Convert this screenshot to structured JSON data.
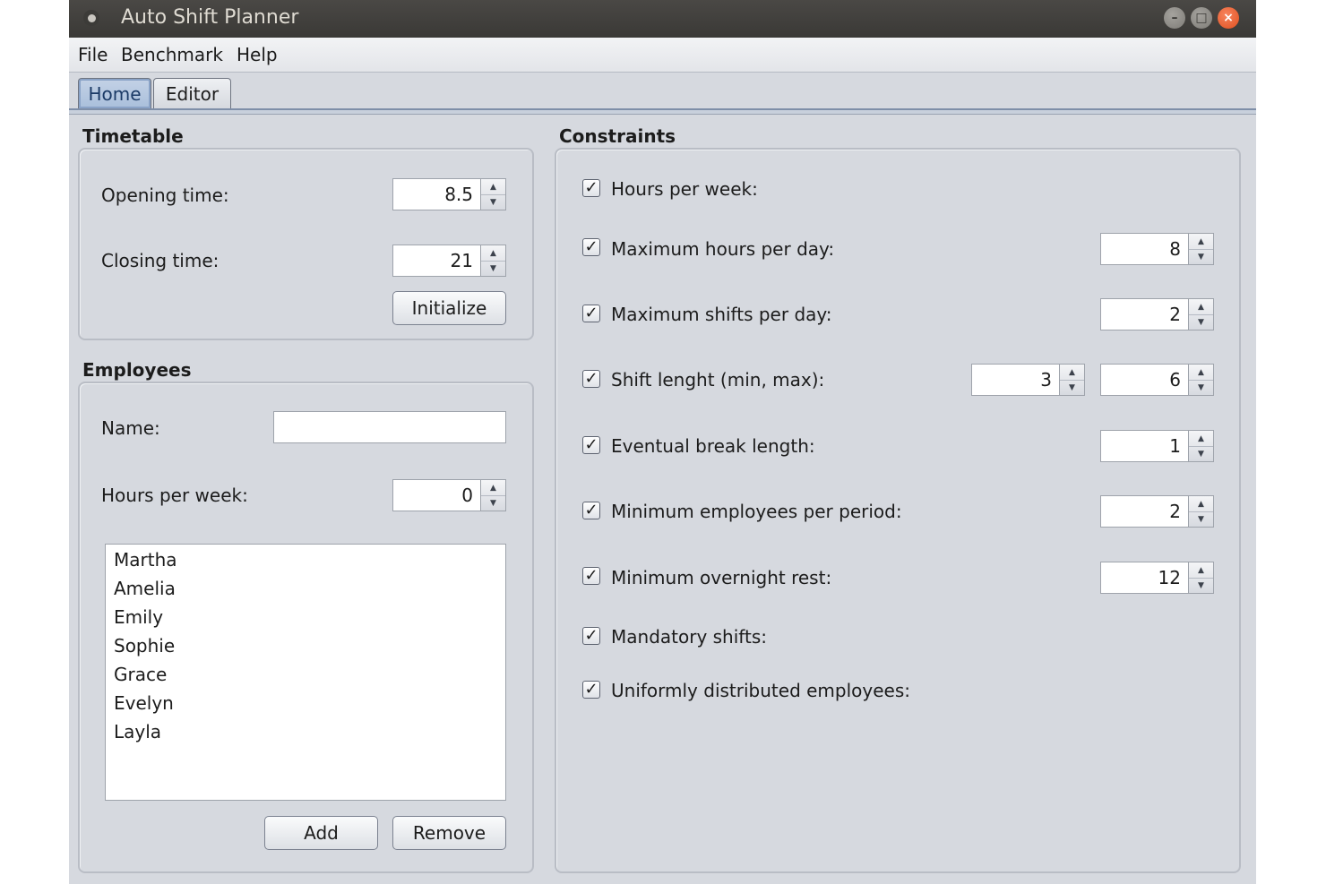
{
  "window": {
    "title": "Auto Shift Planner",
    "controls": {
      "minimize": "–",
      "maximize": "□",
      "close": "×"
    }
  },
  "menu": [
    "File",
    "Benchmark",
    "Help"
  ],
  "tabs": [
    {
      "label": "Home",
      "active": true
    },
    {
      "label": "Editor",
      "active": false
    }
  ],
  "timetable": {
    "title": "Timetable",
    "opening_label": "Opening time:",
    "opening_value": "8.5",
    "closing_label": "Closing time:",
    "closing_value": "21",
    "initialize_button": "Initialize"
  },
  "employees": {
    "title": "Employees",
    "name_label": "Name:",
    "name_value": "",
    "hours_label": "Hours per week:",
    "hours_value": "0",
    "list": [
      "Martha",
      "Amelia",
      "Emily",
      "Sophie",
      "Grace",
      "Evelyn",
      "Layla"
    ],
    "add_button": "Add",
    "remove_button": "Remove"
  },
  "constraints": {
    "title": "Constraints",
    "check_glyph": "✓",
    "items": [
      {
        "label": "Hours per week:",
        "checked": true,
        "values": []
      },
      {
        "label": "Maximum hours per day:",
        "checked": true,
        "values": [
          "8"
        ]
      },
      {
        "label": "Maximum shifts per day:",
        "checked": true,
        "values": [
          "2"
        ]
      },
      {
        "label": "Shift lenght (min, max):",
        "checked": true,
        "values": [
          "3",
          "6"
        ]
      },
      {
        "label": "Eventual break length:",
        "checked": true,
        "values": [
          "1"
        ]
      },
      {
        "label": "Minimum employees per period:",
        "checked": true,
        "values": [
          "2"
        ]
      },
      {
        "label": "Minimum overnight rest:",
        "checked": true,
        "values": [
          "12"
        ]
      },
      {
        "label": "Mandatory shifts:",
        "checked": true,
        "values": []
      },
      {
        "label": "Uniformly distributed employees:",
        "checked": true,
        "values": []
      }
    ]
  },
  "icons": {
    "spinner_up": "▲",
    "spinner_down": "▼",
    "app": "app-icon"
  }
}
